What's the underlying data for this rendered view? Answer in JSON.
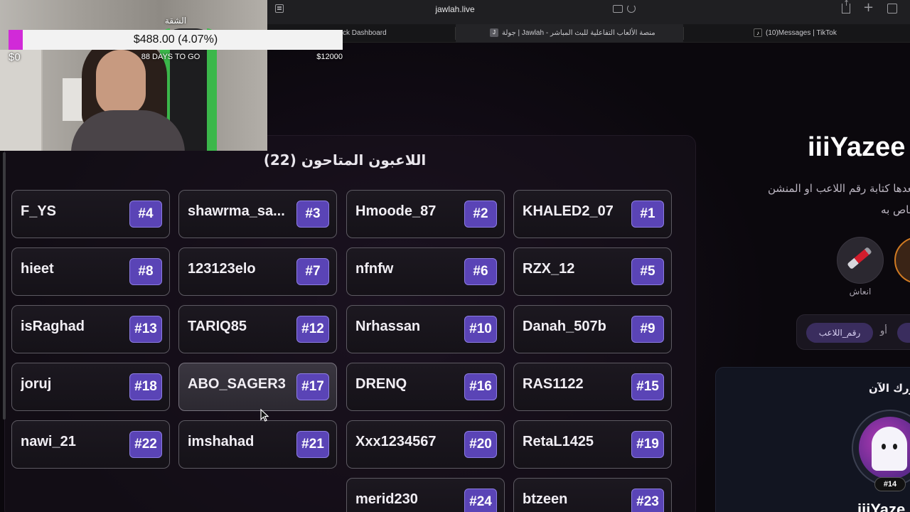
{
  "browser": {
    "url": "jawlah.live",
    "tabs": [
      {
        "label": "ck Dashboard"
      },
      {
        "label": "جولة | Jawlah - منصة الألعاب التفاعلية للبث المباشر",
        "favicon": "J"
      },
      {
        "label": "(10)Messages | TikTok"
      }
    ]
  },
  "goal": {
    "title": "الشقة",
    "amount_text": "$488.00 (4.07%)",
    "progress_fraction": 0.0407,
    "min_label": "$0",
    "max_label": "$12000",
    "days_left": "88 DAYS TO GO",
    "fill_color": "#d12ad8"
  },
  "panel": {
    "title": "اللاعبون المتاحون (22)",
    "players": [
      {
        "name": "KHALED2_07",
        "num": "#1"
      },
      {
        "name": "Hmoode_87",
        "num": "#2"
      },
      {
        "name": "shawrma_sa...",
        "num": "#3"
      },
      {
        "name": "F_YS",
        "num": "#4"
      },
      {
        "name": "RZX_12",
        "num": "#5"
      },
      {
        "name": "nfnfw",
        "num": "#6"
      },
      {
        "name": "123123elo",
        "num": "#7"
      },
      {
        "name": "hieet",
        "num": "#8"
      },
      {
        "name": "Danah_507b",
        "num": "#9"
      },
      {
        "name": "Nrhassan",
        "num": "#10"
      },
      {
        "name": "TARIQ85",
        "num": "#12"
      },
      {
        "name": "isRaghad",
        "num": "#13"
      },
      {
        "name": "RAS1122",
        "num": "#15"
      },
      {
        "name": "DRENQ",
        "num": "#16"
      },
      {
        "name": "ABO_SAGER3",
        "num": "#17"
      },
      {
        "name": "joruj",
        "num": "#18"
      },
      {
        "name": "RetaL1425",
        "num": "#19"
      },
      {
        "name": "Xxx1234567",
        "num": "#20"
      },
      {
        "name": "imshahad",
        "num": "#21"
      },
      {
        "name": "nawi_21",
        "num": "#22"
      },
      {
        "name": "btzeen",
        "num": "#23"
      },
      {
        "name": "merid230",
        "num": "#24"
      }
    ]
  },
  "right": {
    "name": "iiiYazee",
    "desc_line1": "بعدها كتابة رقم اللاعب او المنشن",
    "desc_line2": "خاص به",
    "gift_label": "انعاش",
    "chip_label": "رقم_اللاعب",
    "or_label": "أو",
    "share_title": "ورك الآن",
    "rank": "#14",
    "bottom_name": "iiiYaze"
  }
}
